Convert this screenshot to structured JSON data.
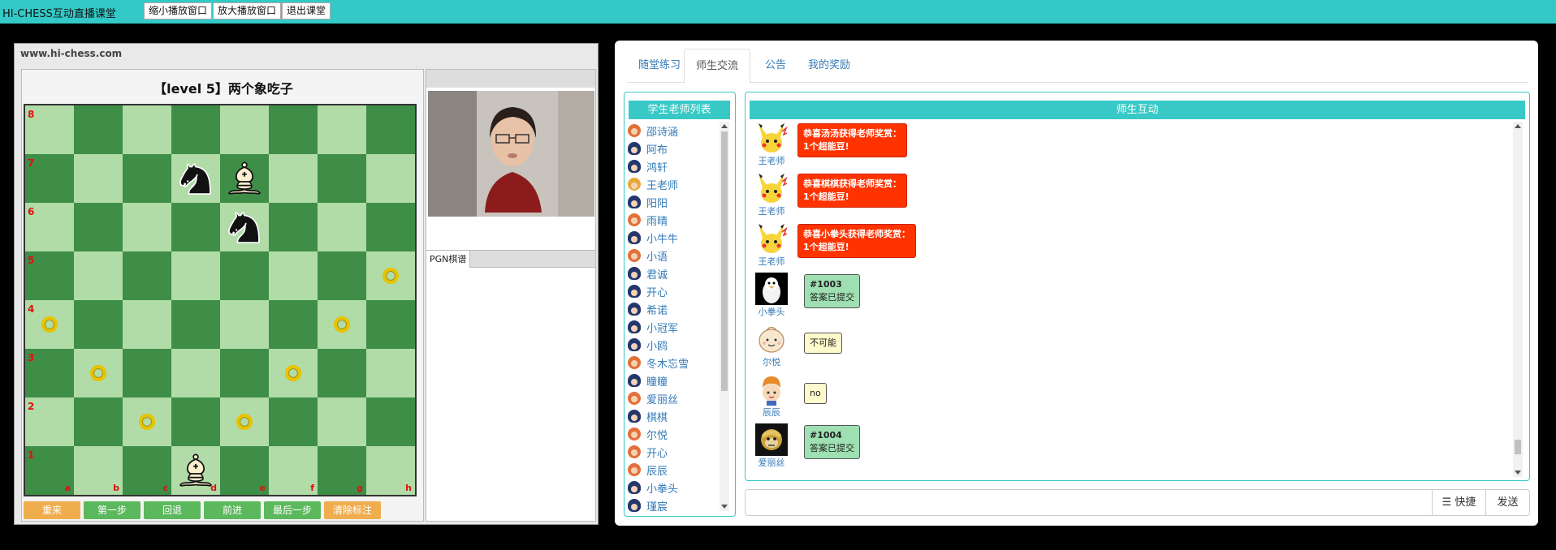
{
  "app": {
    "title": "HI-CHESS互动直播课堂",
    "buttons": [
      "缩小播放窗口",
      "放大播放窗口",
      "退出课堂"
    ]
  },
  "board_panel": {
    "site": "www.hi-chess.com",
    "title": "【level 5】两个象吃子",
    "files": [
      "a",
      "b",
      "c",
      "d",
      "e",
      "f",
      "g",
      "h"
    ],
    "ranks": [
      "8",
      "7",
      "6",
      "5",
      "4",
      "3",
      "2",
      "1"
    ],
    "pieces": [
      {
        "square": "d7",
        "type": "knight",
        "color": "black"
      },
      {
        "square": "e7",
        "type": "bishop",
        "color": "white"
      },
      {
        "square": "e6",
        "type": "knight",
        "color": "black"
      },
      {
        "square": "d1",
        "type": "bishop",
        "color": "white"
      }
    ],
    "markers": [
      "h5",
      "a4",
      "g4",
      "b3",
      "f3",
      "c2",
      "e2"
    ],
    "controls": [
      {
        "label": "重来",
        "style": "orange"
      },
      {
        "label": "第一步",
        "style": "green"
      },
      {
        "label": "回退",
        "style": "green"
      },
      {
        "label": "前进",
        "style": "green"
      },
      {
        "label": "最后一步",
        "style": "green"
      },
      {
        "label": "清除标注",
        "style": "orange"
      }
    ],
    "pgn_tab": "PGN棋谱"
  },
  "right_panel": {
    "tabs": [
      {
        "label": "随堂练习",
        "active": false
      },
      {
        "label": "师生交流",
        "active": true
      },
      {
        "label": "公告",
        "active": false
      },
      {
        "label": "我的奖励",
        "active": false
      }
    ],
    "list_title": "学生老师列表",
    "members": [
      {
        "name": "邵诗涵",
        "avatar": "girl"
      },
      {
        "name": "阿布",
        "avatar": "boy"
      },
      {
        "name": "鸿轩",
        "avatar": "boy"
      },
      {
        "name": "王老师",
        "avatar": "king"
      },
      {
        "name": "阳阳",
        "avatar": "boy"
      },
      {
        "name": "雨晴",
        "avatar": "girl"
      },
      {
        "name": "小牛牛",
        "avatar": "boy"
      },
      {
        "name": "小语",
        "avatar": "girl"
      },
      {
        "name": "君诚",
        "avatar": "boy"
      },
      {
        "name": "开心",
        "avatar": "boy"
      },
      {
        "name": "希诺",
        "avatar": "boy"
      },
      {
        "name": "小冠军",
        "avatar": "boy"
      },
      {
        "name": "小鸥",
        "avatar": "boy"
      },
      {
        "name": "冬木忘雪",
        "avatar": "girl"
      },
      {
        "name": "瞳瞳",
        "avatar": "boy"
      },
      {
        "name": "爱丽丝",
        "avatar": "girl"
      },
      {
        "name": "棋棋",
        "avatar": "boy"
      },
      {
        "name": "尔悦",
        "avatar": "girl"
      },
      {
        "name": "开心",
        "avatar": "girl"
      },
      {
        "name": "辰辰",
        "avatar": "girl"
      },
      {
        "name": "小拳头",
        "avatar": "boy"
      },
      {
        "name": "瑾宸",
        "avatar": "boy"
      }
    ],
    "chat_title": "师生互动",
    "messages": [
      {
        "name": "王老师",
        "avatar": "pikachu",
        "style": "red",
        "line1": "恭喜汤汤获得老师奖赏：",
        "line2": "1个超能豆!"
      },
      {
        "name": "王老师",
        "avatar": "pikachu",
        "style": "red",
        "line1": "恭喜棋棋获得老师奖赏：",
        "line2": "1个超能豆!"
      },
      {
        "name": "王老师",
        "avatar": "pikachu",
        "style": "red",
        "line1": "恭喜小拳头获得老师奖赏：",
        "line2": "1个超能豆!"
      },
      {
        "name": "小拳头",
        "avatar": "penguin",
        "style": "green",
        "line1": "#1003",
        "line2": "答案已提交"
      },
      {
        "name": "尔悦",
        "avatar": "bun",
        "style": "yellow",
        "line1": "不可能",
        "line2": ""
      },
      {
        "name": "辰辰",
        "avatar": "chef",
        "style": "yellow",
        "line1": "no",
        "line2": ""
      },
      {
        "name": "爱丽丝",
        "avatar": "monkey",
        "style": "green",
        "line1": "#1004",
        "line2": "答案已提交"
      }
    ],
    "input_placeholder": "",
    "quick_label": "快捷",
    "send_label": "发送"
  }
}
